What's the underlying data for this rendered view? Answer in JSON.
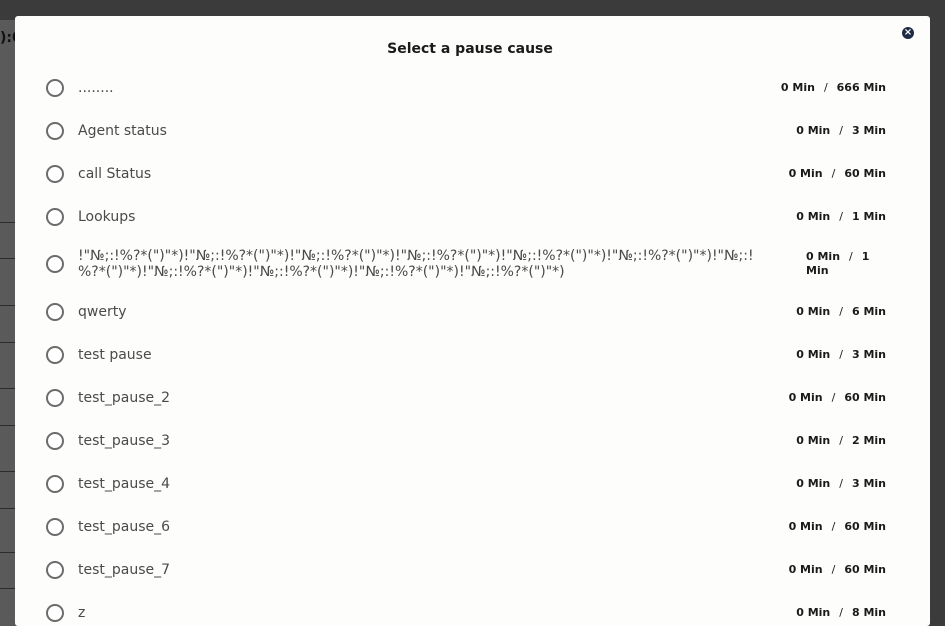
{
  "background": {
    "fragment_text": "):0"
  },
  "dialog": {
    "title": "Select a pause cause",
    "close_icon": "close-circle-icon",
    "separator": "/",
    "causes": [
      {
        "label": "........",
        "used": "0 Min",
        "limit": "666 Min"
      },
      {
        "label": "Agent status",
        "used": "0 Min",
        "limit": "3 Min"
      },
      {
        "label": "call Status",
        "used": "0 Min",
        "limit": "60 Min"
      },
      {
        "label": "Lookups",
        "used": "0 Min",
        "limit": "1 Min"
      },
      {
        "label": "!\"№;:!%?*(\")\"*)!\"№;:!%?*(\")\"*)!\"№;:!%?*(\")\"*)!\"№;:!%?*(\")\"*)!\"№;:!%?*(\")\"*)!\"№;:!%?*(\")\"*)!\"№;:!%?*(\")\"*)!\"№;:!%?*(\")\"*)!\"№;:!%?*(\")\"*)!\"№;:!%?*(\")\"*)!\"№;:!%?*(\")\"*)",
        "used": "0 Min",
        "limit": "1 Min"
      },
      {
        "label": "qwerty",
        "used": "0 Min",
        "limit": "6 Min"
      },
      {
        "label": "test pause",
        "used": "0 Min",
        "limit": "3 Min"
      },
      {
        "label": "test_pause_2",
        "used": "0 Min",
        "limit": "60 Min"
      },
      {
        "label": "test_pause_3",
        "used": "0 Min",
        "limit": "2 Min"
      },
      {
        "label": "test_pause_4",
        "used": "0 Min",
        "limit": "3 Min"
      },
      {
        "label": "test_pause_6",
        "used": "0 Min",
        "limit": "60 Min"
      },
      {
        "label": "test_pause_7",
        "used": "0 Min",
        "limit": "60 Min"
      },
      {
        "label": "z",
        "used": "0 Min",
        "limit": "8 Min"
      }
    ]
  }
}
